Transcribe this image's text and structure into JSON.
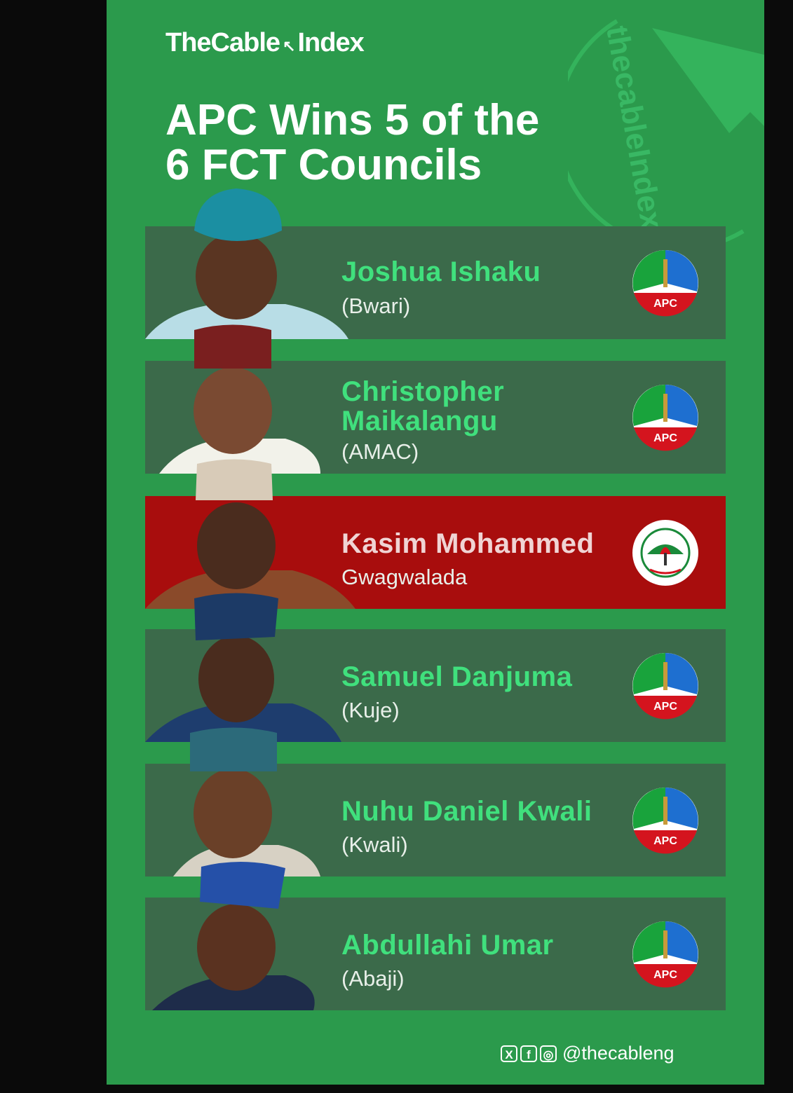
{
  "brand": {
    "name": "TheCable",
    "suffix": "Index"
  },
  "headline": {
    "line1": "APC Wins 5 of the",
    "line2": "6 FCT Councils"
  },
  "watermark": "thecableIndex",
  "colors": {
    "background": "#2b9a4c",
    "row": "#3b6a4a",
    "pdp_row": "#a80d0d",
    "name": "#40e07d"
  },
  "winners": [
    {
      "name_lines": [
        "Joshua Ishaku"
      ],
      "council": "(Bwari)",
      "party": "APC"
    },
    {
      "name_lines": [
        "Christopher",
        "Maikalangu"
      ],
      "council": "(AMAC)",
      "party": "APC"
    },
    {
      "name_lines": [
        "Kasim Mohammed"
      ],
      "council": "Gwagwalada",
      "party": "PDP"
    },
    {
      "name_lines": [
        "Samuel Danjuma"
      ],
      "council": "(Kuje)",
      "party": "APC"
    },
    {
      "name_lines": [
        "Nuhu Daniel Kwali"
      ],
      "council": "(Kwali)",
      "party": "APC"
    },
    {
      "name_lines": [
        "Abdullahi Umar"
      ],
      "council": "(Abaji)",
      "party": "APC"
    }
  ],
  "logos": {
    "apc_text": "APC",
    "pdp_text": "PEOPLES DEMOCRATIC PARTY"
  },
  "footer": {
    "icons": [
      "x-icon",
      "facebook-icon",
      "instagram-icon"
    ],
    "handle": "@thecableng"
  }
}
